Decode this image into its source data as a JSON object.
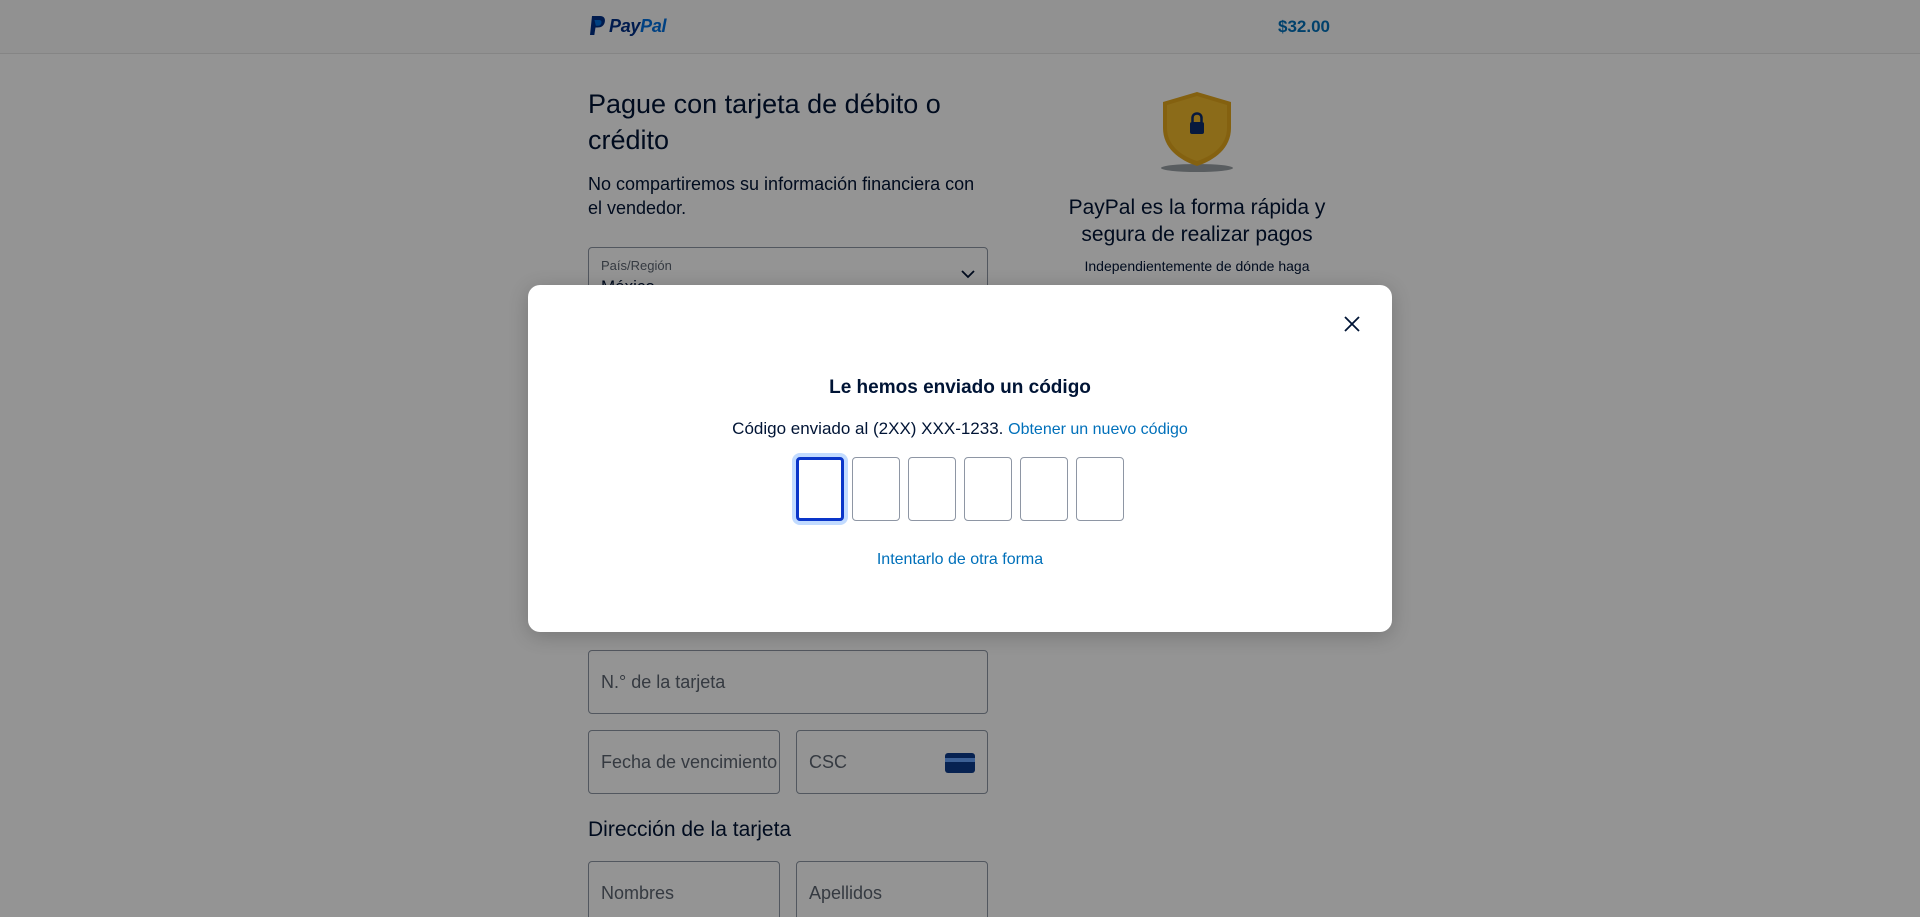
{
  "header": {
    "logo_pay": "Pay",
    "logo_pal": "Pal",
    "amount": "$32.00"
  },
  "form": {
    "title": "Pague con tarjeta de débito o crédito",
    "subtitle": "No compartiremos su información financiera con el vendedor.",
    "country_label": "País/Región",
    "country_value": "México",
    "card_number_placeholder": "N.° de la tarjeta",
    "expiry_placeholder": "Fecha de vencimiento",
    "csc_placeholder": "CSC",
    "billing_section_title": "Dirección de la tarjeta",
    "first_name_placeholder": "Nombres",
    "last_name_placeholder": "Apellidos"
  },
  "promo": {
    "title": "PayPal es la forma rápida y segura de realizar pagos",
    "text": "Independientemente de dónde haga"
  },
  "modal": {
    "title": "Le hemos enviado un código",
    "sent_text": "Código enviado al (2XX) XXX-1233.",
    "new_code_link": "Obtener un nuevo código",
    "alt_link": "Intentarlo de otra forma",
    "code_length": 6
  },
  "colors": {
    "brand_dark": "#003087",
    "brand_light": "#0070e0",
    "link": "#0070ba",
    "focus": "#0a35c9",
    "shield_gold": "#f0b82b"
  },
  "icons": {
    "close": "close-icon",
    "shield": "shield-lock-icon",
    "card": "credit-card-icon",
    "chevron": "chevron-down-icon"
  }
}
